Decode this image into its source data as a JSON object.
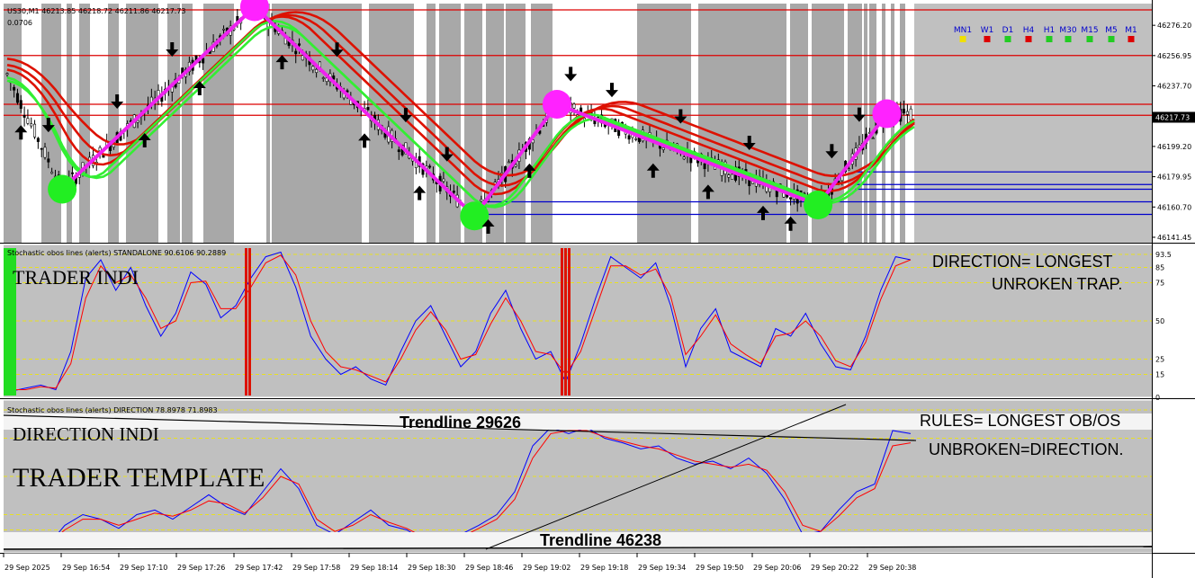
{
  "symbol_header": {
    "text": "US30,M1  46213.85 46218.72 46211.86 46217.73",
    "subline": "0.0706"
  },
  "timeframes": {
    "labels": [
      "MN1",
      "W1",
      "D1",
      "H4",
      "H1",
      "M30",
      "M15",
      "M5",
      "M1"
    ],
    "colors": [
      "#f0e000",
      "#dd0000",
      "#22cc22",
      "#dd0000",
      "#22cc22",
      "#22cc22",
      "#22cc22",
      "#22cc22",
      "#dd0000"
    ]
  },
  "colors": {
    "stoch_main": "#0000ff",
    "stoch_signal": "#ff0000",
    "ma_red": "#dd1100",
    "ma_green": "#33ee33",
    "swing_line": "#ee22ee",
    "swing_top": "#ff22ff",
    "swing_bottom": "#22ee22",
    "level_red": "#dd0000",
    "level_blue": "#0000cc",
    "ob_os_bar_red": "#dd1100",
    "ob_os_bar_green": "#22dd22"
  },
  "labels": {
    "trader_indi": "TRADER INDI",
    "direction_indi": "DIRECTION INDI",
    "trader_template": "TRADER TEMPLATE",
    "trendline_top": "Trendline 29626",
    "trendline_bottom": "Trendline 46238",
    "direction_note_line1": "DIRECTION= LONGEST",
    "direction_note_line2": "UNROKEN TRAP.",
    "rules_note_line1": "RULES= LONGEST OB/OS",
    "rules_note_line2": "UNBROKEN=DIRECTION."
  },
  "chart_data": [
    {
      "type": "candlestick",
      "panel": "price",
      "price_axis_ticks": [
        "46276.20",
        "46256.95",
        "46237.70",
        "46217.73",
        "46199.20",
        "46179.95",
        "46160.70",
        "46141.45"
      ],
      "ylim": [
        46138,
        46290
      ],
      "current_price": 46217.73,
      "horizontal_levels_red": [
        46286,
        46257,
        46226,
        46219
      ],
      "horizontal_levels_blue": [
        46183,
        46175,
        46172,
        46164,
        46156
      ],
      "swing_points": [
        {
          "time_index": 4,
          "price": 46172,
          "kind": "low"
        },
        {
          "time_index": 18,
          "price": 46288,
          "kind": "high"
        },
        {
          "time_index": 34,
          "price": 46155,
          "kind": "low"
        },
        {
          "time_index": 40,
          "price": 46226,
          "kind": "high"
        },
        {
          "time_index": 59,
          "price": 46162,
          "kind": "low"
        },
        {
          "time_index": 64,
          "price": 46220,
          "kind": "high"
        }
      ],
      "x_tick_labels": [
        "29 Sep 2025",
        "29 Sep 16:54",
        "29 Sep 17:10",
        "29 Sep 17:26",
        "29 Sep 17:42",
        "29 Sep 17:58",
        "29 Sep 18:14",
        "29 Sep 18:30",
        "29 Sep 18:46",
        "29 Sep 19:02",
        "29 Sep 19:18",
        "29 Sep 19:34",
        "29 Sep 19:50",
        "29 Sep 20:06",
        "29 Sep 20:22",
        "29 Sep 20:38"
      ]
    },
    {
      "type": "line",
      "panel": "stochastic_trader",
      "title": "Stochastic obos lines (alerts) STANDALONE 90.6106 90.2889",
      "levels": [
        100,
        93.5,
        85,
        75,
        50,
        25,
        15,
        0
      ],
      "level_labels": [
        "93.5",
        "85",
        "75",
        "50",
        "25",
        "15",
        "0"
      ],
      "ylim": [
        0,
        100
      ],
      "series": [
        {
          "name": "main",
          "values": [
            4,
            6,
            8,
            5,
            30,
            78,
            90,
            70,
            85,
            60,
            40,
            55,
            82,
            74,
            52,
            60,
            78,
            92,
            95,
            72,
            40,
            25,
            15,
            20,
            12,
            8,
            30,
            50,
            60,
            40,
            20,
            30,
            55,
            70,
            45,
            25,
            30,
            10,
            35,
            65,
            92,
            85,
            78,
            88,
            60,
            20,
            45,
            58,
            30,
            25,
            20,
            45,
            40,
            55,
            35,
            20,
            18,
            40,
            70,
            92,
            90
          ]
        },
        {
          "name": "signal",
          "values": [
            5,
            5,
            7,
            6,
            22,
            65,
            86,
            75,
            80,
            65,
            45,
            50,
            75,
            76,
            58,
            58,
            72,
            88,
            93,
            80,
            50,
            30,
            20,
            18,
            14,
            10,
            25,
            44,
            56,
            44,
            25,
            28,
            48,
            65,
            50,
            30,
            28,
            15,
            30,
            58,
            86,
            86,
            80,
            84,
            66,
            28,
            40,
            54,
            35,
            28,
            22,
            40,
            42,
            50,
            40,
            24,
            20,
            36,
            64,
            86,
            90
          ]
        }
      ]
    },
    {
      "type": "line",
      "panel": "stochastic_direction",
      "title": "Stochastic obos lines (alerts) DIRECTION 78.8978 71.8983",
      "levels": [
        100,
        93.5,
        85,
        75,
        50,
        25,
        15,
        0
      ],
      "ylim": [
        0,
        100
      ],
      "series": [
        {
          "name": "main",
          "values": [
            5,
            8,
            4,
            18,
            25,
            22,
            16,
            25,
            28,
            22,
            30,
            38,
            30,
            25,
            40,
            55,
            42,
            18,
            12,
            20,
            28,
            18,
            15,
            8,
            5,
            12,
            18,
            25,
            40,
            70,
            82,
            78,
            82,
            75,
            72,
            68,
            70,
            62,
            58,
            60,
            55,
            62,
            52,
            35,
            12,
            14,
            28,
            40,
            45,
            80,
            78
          ]
        },
        {
          "name": "signal",
          "values": [
            6,
            7,
            5,
            15,
            22,
            22,
            18,
            22,
            26,
            24,
            28,
            34,
            32,
            26,
            36,
            50,
            45,
            22,
            14,
            18,
            25,
            20,
            16,
            10,
            6,
            10,
            16,
            22,
            35,
            62,
            78,
            80,
            80,
            76,
            73,
            70,
            68,
            64,
            60,
            58,
            56,
            58,
            54,
            40,
            18,
            14,
            24,
            36,
            42,
            70,
            72
          ]
        }
      ]
    }
  ]
}
